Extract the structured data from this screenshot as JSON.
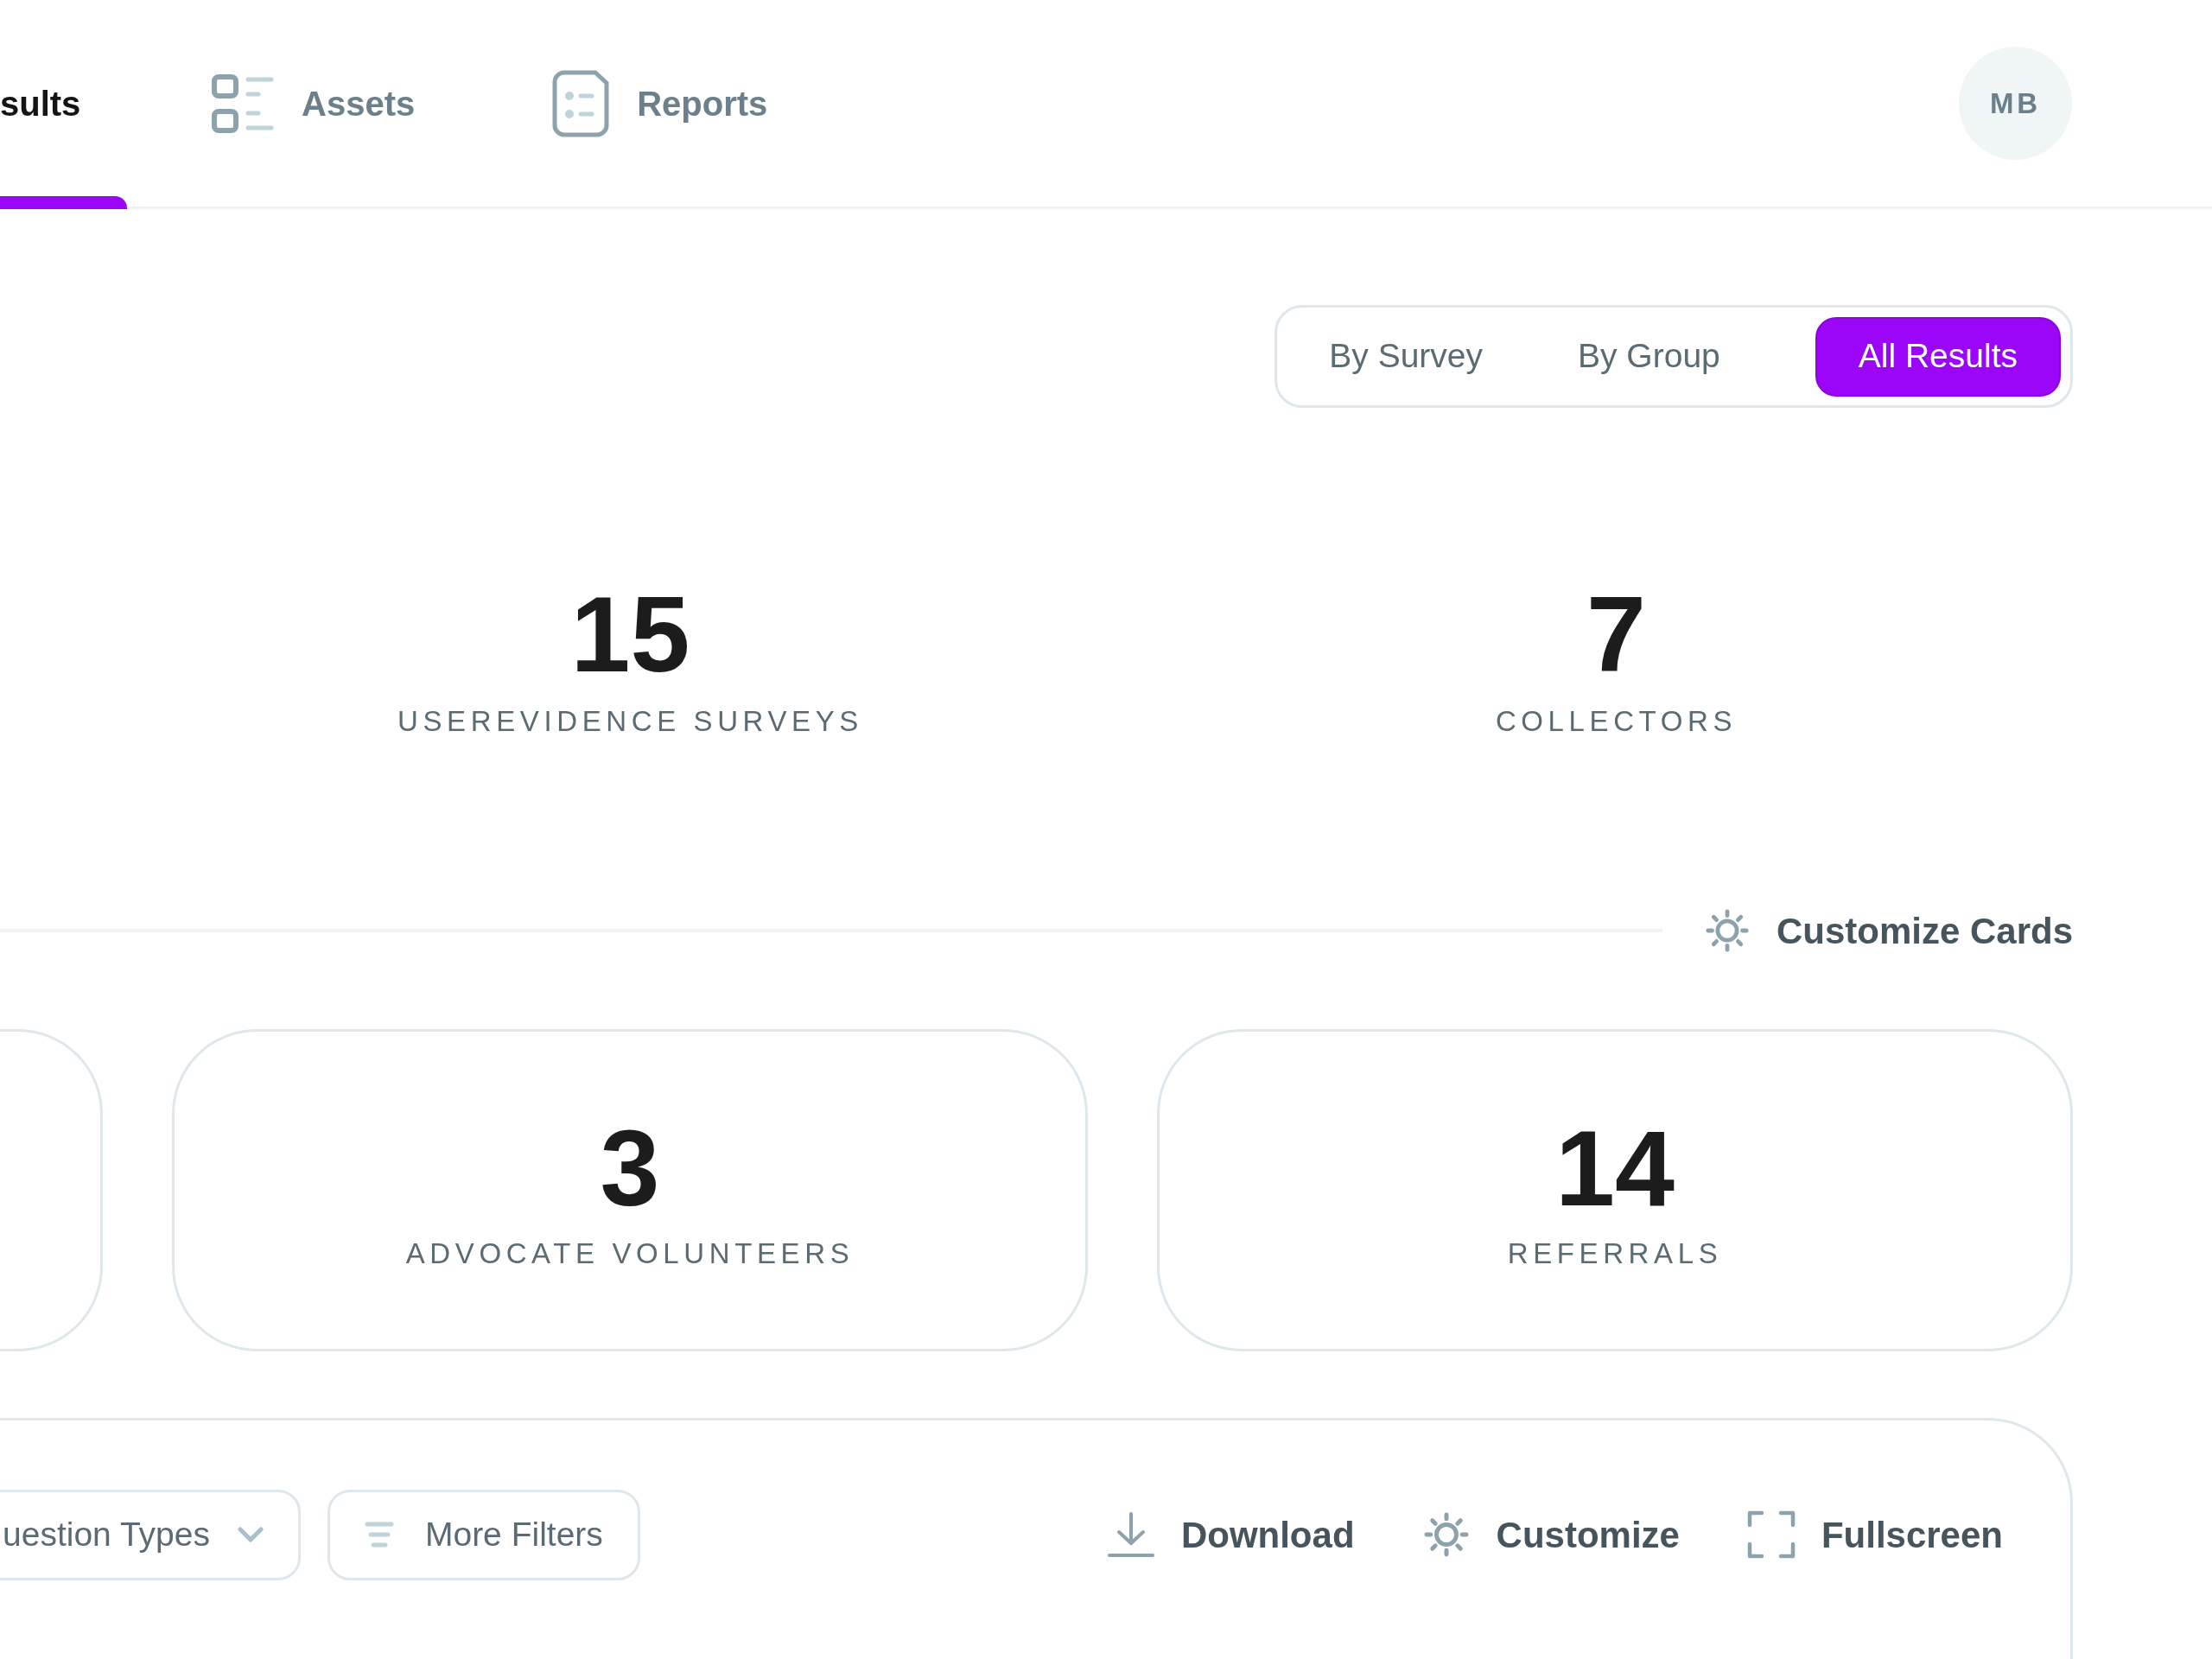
{
  "nav": {
    "tabs": [
      {
        "label": "sults",
        "selected": true,
        "kind": "plain"
      },
      {
        "label": "Assets",
        "selected": false,
        "kind": "list"
      },
      {
        "label": "Reports",
        "selected": false,
        "kind": "report"
      }
    ],
    "avatar": "MB"
  },
  "view_toggle": [
    {
      "label": "By Survey",
      "selected": false
    },
    {
      "label": "By Group",
      "selected": false
    },
    {
      "label": "All Results",
      "selected": true
    }
  ],
  "summary": [
    {
      "value": "15",
      "label": "USEREVIDENCE SURVEYS"
    },
    {
      "value": "7",
      "label": "COLLECTORS"
    }
  ],
  "customize_cards": "Customize Cards",
  "cards": [
    {
      "value": "3",
      "label": "ADVOCATE VOLUNTEERS"
    },
    {
      "value": "14",
      "label": "REFERRALS"
    }
  ],
  "filters": [
    {
      "label": "uestion Types",
      "kind": "dropdown"
    },
    {
      "label": "More Filters",
      "kind": "filter"
    }
  ],
  "actions": [
    {
      "label": "Download",
      "kind": "download"
    },
    {
      "label": "Customize",
      "kind": "gear"
    },
    {
      "label": "Fullscreen",
      "kind": "fullscreen"
    }
  ]
}
